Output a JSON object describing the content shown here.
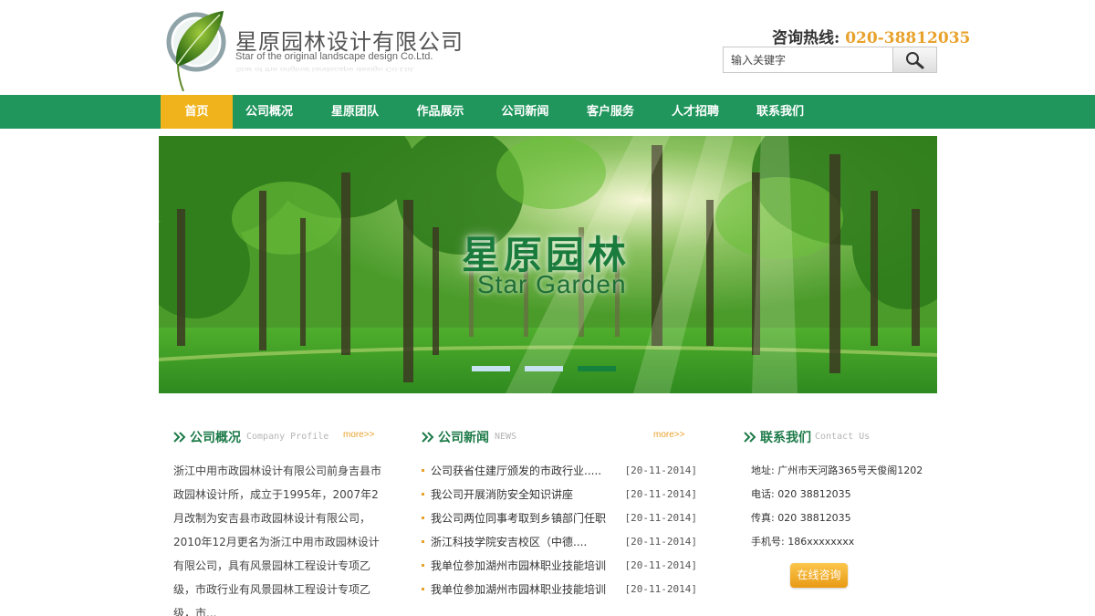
{
  "header": {
    "company_name_cn": "星原园林设计有限公司",
    "company_name_en": "Star of the original landscape design Co.Ltd.",
    "hotline_label": "咨询热线:",
    "hotline_number": "020-38812035",
    "search": {
      "value": "输入关键字",
      "icon": "search-icon"
    },
    "logo_icon": "leaf-logo-icon"
  },
  "nav": {
    "items": [
      {
        "label": "首页",
        "active": true
      },
      {
        "label": "公司概况"
      },
      {
        "label": "星原团队"
      },
      {
        "label": "作品展示"
      },
      {
        "label": "公司新闻"
      },
      {
        "label": "客户服务"
      },
      {
        "label": "人才招聘"
      },
      {
        "label": "联系我们"
      }
    ]
  },
  "banner": {
    "title_cn": "星原园林",
    "title_en": "Star Garden",
    "slide_count": 3,
    "active_slide": 3
  },
  "profile": {
    "title": "公司概况",
    "subtitle": "Company Profile",
    "more": "more>>",
    "text": "浙江中用市政园林设计有限公司前身吉县市政园林设计所，成立于1995年，2007年2月改制为安吉县市政园林设计有限公司，2010年12月更名为浙江中用市政园林设计有限公司，具有风景园林工程设计专项乙级，市政行业有风景园林工程设计专项乙级，市..."
  },
  "news": {
    "title": "公司新闻",
    "subtitle": "NEWS",
    "more": "more>>",
    "items": [
      {
        "title": "公司获省住建厅颁发的市政行业.....",
        "date": "[20-11-2014]"
      },
      {
        "title": "我公司开展消防安全知识讲座",
        "date": "[20-11-2014]"
      },
      {
        "title": "我公司两位同事考取到乡镇部门任职",
        "date": "[20-11-2014]"
      },
      {
        "title": "浙江科技学院安吉校区（中德....",
        "date": "[20-11-2014]"
      },
      {
        "title": "我单位参加湖州市园林职业技能培训",
        "date": "[20-11-2014]"
      },
      {
        "title": "我单位参加湖州市园林职业技能培训",
        "date": "[20-11-2014]"
      }
    ]
  },
  "contact": {
    "title": "联系我们",
    "subtitle": "Contact Us",
    "address": "地址: 广州市天河路365号天俊阁1202",
    "phone": "电话: 020 38812035",
    "fax": "传真: 020 38812035",
    "mobile": "手机号: 186xxxxxxxx",
    "consult_button": "在线咨询"
  },
  "colors": {
    "nav_green": "#20965d",
    "active_orange": "#f1b31b",
    "title_green": "#1c7a48",
    "accent_orange": "#e8a22c"
  }
}
